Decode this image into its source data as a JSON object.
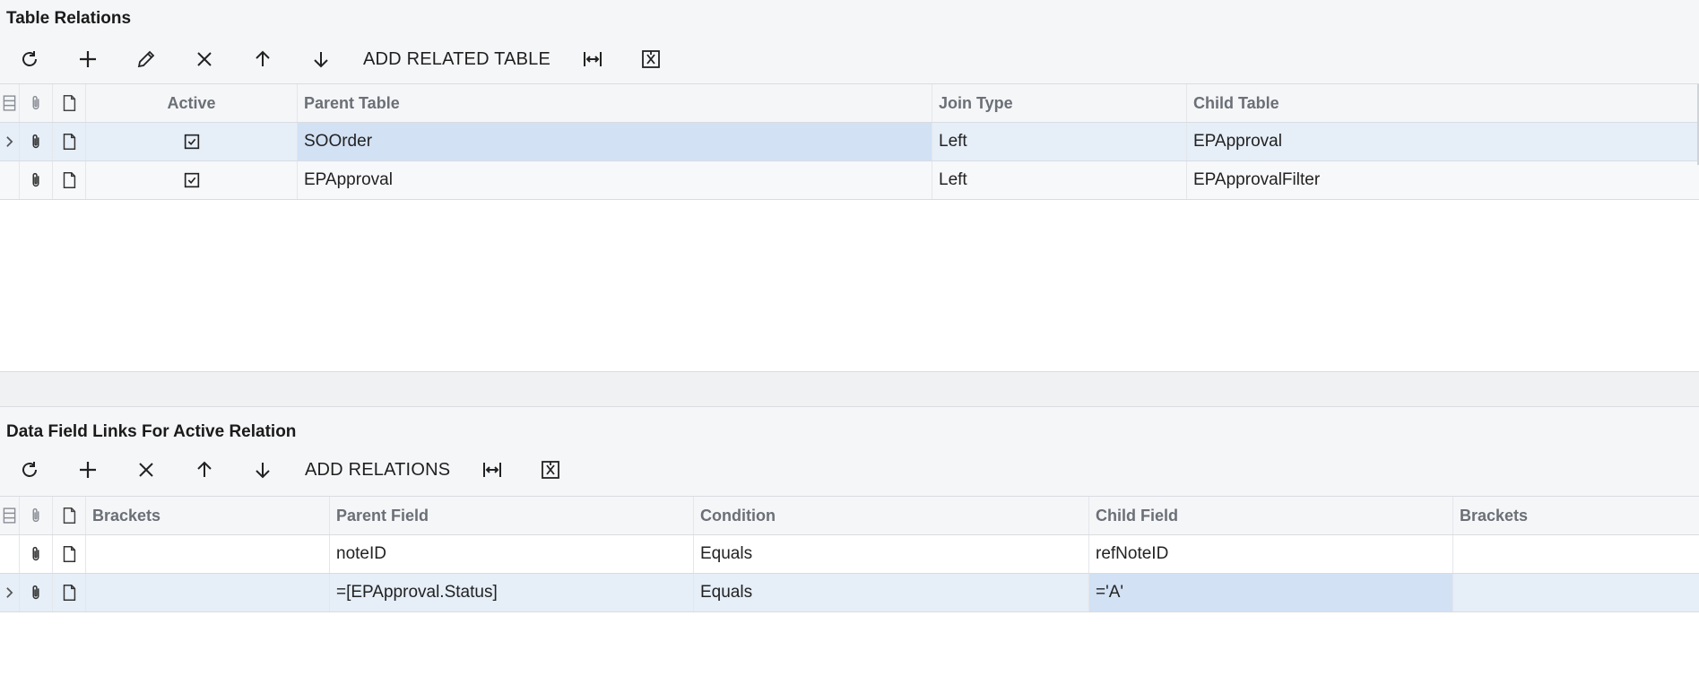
{
  "table_relations": {
    "title": "Table Relations",
    "toolbar": {
      "refresh_icon": "refresh-icon",
      "add_icon": "plus-icon",
      "edit_icon": "pencil-icon",
      "delete_icon": "x-icon",
      "up_icon": "arrow-up-icon",
      "down_icon": "arrow-down-icon",
      "add_related_label": "ADD RELATED TABLE",
      "fit_icon": "fit-columns-icon",
      "excel_icon": "excel-export-icon"
    },
    "columns": [
      "Active",
      "Parent Table",
      "Join Type",
      "Child Table"
    ],
    "rows": [
      {
        "active": true,
        "parent_table": "SOOrder",
        "join_type": "Left",
        "child_table": "EPApproval"
      },
      {
        "active": true,
        "parent_table": "EPApproval",
        "join_type": "Left",
        "child_table": "EPApprovalFilter"
      }
    ]
  },
  "data_field_links": {
    "title": "Data Field Links For Active Relation",
    "toolbar": {
      "refresh_icon": "refresh-icon",
      "add_icon": "plus-icon",
      "delete_icon": "x-icon",
      "up_icon": "arrow-up-icon",
      "down_icon": "arrow-down-icon",
      "add_relations_label": "ADD RELATIONS",
      "fit_icon": "fit-columns-icon",
      "excel_icon": "excel-export-icon"
    },
    "columns": [
      "Brackets",
      "Parent Field",
      "Condition",
      "Child Field",
      "Brackets"
    ],
    "rows": [
      {
        "brackets_open": "",
        "parent_field": "noteID",
        "condition": "Equals",
        "child_field": "refNoteID",
        "brackets_close": ""
      },
      {
        "brackets_open": "",
        "parent_field": "=[EPApproval.Status]",
        "condition": "Equals",
        "child_field": "='A'",
        "brackets_close": ""
      }
    ]
  },
  "colors": {
    "accent": "#2c6fb7",
    "selected_row": "#e6eef8",
    "selected_cell": "#d2e1f4",
    "header_bg": "#f5f6f8"
  }
}
